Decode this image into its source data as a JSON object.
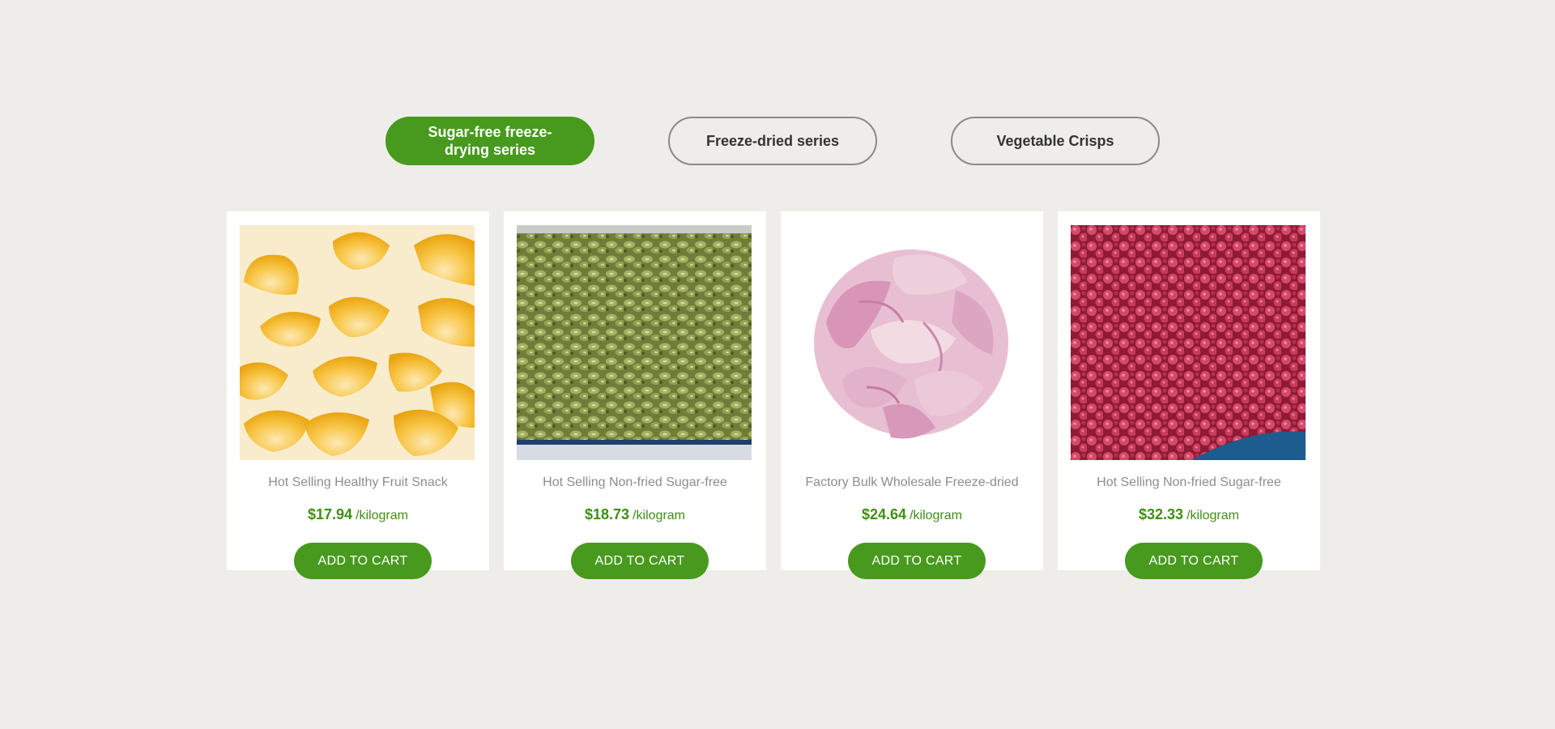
{
  "tabs": [
    {
      "label": "Sugar-free freeze-drying series",
      "active": true
    },
    {
      "label": "Freeze-dried series",
      "active": false
    },
    {
      "label": "Vegetable Crisps",
      "active": false
    }
  ],
  "products": [
    {
      "title": "Hot Selling Healthy Fruit Snack",
      "price": "$17.94",
      "unit": "/kilogram",
      "button": "ADD TO CART",
      "image": "freeze-dried-mandarin-segments"
    },
    {
      "title": "Hot Selling Non-fried Sugar-free",
      "price": "$18.73",
      "unit": "/kilogram",
      "button": "ADD TO CART",
      "image": "freeze-dried-kiwi-slices-tray"
    },
    {
      "title": "Factory Bulk Wholesale Freeze-dried",
      "price": "$24.64",
      "unit": "/kilogram",
      "button": "ADD TO CART",
      "image": "freeze-dried-peach-slices-pile"
    },
    {
      "title": "Hot Selling Non-fried Sugar-free",
      "price": "$32.33",
      "unit": "/kilogram",
      "button": "ADD TO CART",
      "image": "freeze-dried-raspberries"
    }
  ],
  "colors": {
    "accent": "#479a1d",
    "price": "#3f8f16",
    "background": "#eeede9",
    "card": "#ffffff",
    "title_text": "#8d8d8d"
  }
}
